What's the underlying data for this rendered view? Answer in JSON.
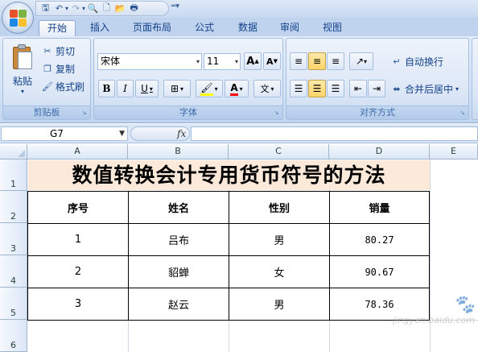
{
  "quick_access": {
    "icons": [
      "save-icon",
      "undo-icon",
      "redo-icon",
      "print-preview-icon",
      "new-document-icon",
      "open-icon",
      "print-icon"
    ]
  },
  "tabs": [
    {
      "label": "开始",
      "active": true
    },
    {
      "label": "插入"
    },
    {
      "label": "页面布局"
    },
    {
      "label": "公式"
    },
    {
      "label": "数据"
    },
    {
      "label": "审阅"
    },
    {
      "label": "视图"
    }
  ],
  "ribbon": {
    "clipboard": {
      "label": "剪贴板",
      "paste": "粘贴",
      "cut": "剪切",
      "copy": "复制",
      "format_painter": "格式刷"
    },
    "font": {
      "label": "字体",
      "font_name": "宋体",
      "font_size": "11",
      "bold": "B",
      "italic": "I",
      "underline": "U",
      "grow": "A",
      "shrink": "A",
      "font_color_letter": "A",
      "phonetic": "文"
    },
    "alignment": {
      "label": "对齐方式",
      "wrap_text": "自动换行",
      "merge_center": "合并后居中"
    }
  },
  "formula_bar": {
    "name_box": "G7",
    "fx": "fx",
    "formula": ""
  },
  "grid": {
    "columns": [
      "A",
      "B",
      "C",
      "D",
      "E"
    ],
    "rows": [
      "1",
      "2",
      "3",
      "4",
      "5",
      "6"
    ],
    "title": "数值转换会计专用货币符号的方法",
    "headers": [
      "序号",
      "姓名",
      "性别",
      "销量"
    ],
    "data": [
      [
        "1",
        "吕布",
        "男",
        "80.27"
      ],
      [
        "2",
        "貂蝉",
        "女",
        "90.67"
      ],
      [
        "3",
        "赵云",
        "男",
        "78.36"
      ]
    ]
  },
  "watermark": "jingyan.baidu.com",
  "colors": {
    "title_fill": "#fde9d9",
    "ribbon_blue": "#dbe6f6",
    "accent_text": "#15428b"
  }
}
